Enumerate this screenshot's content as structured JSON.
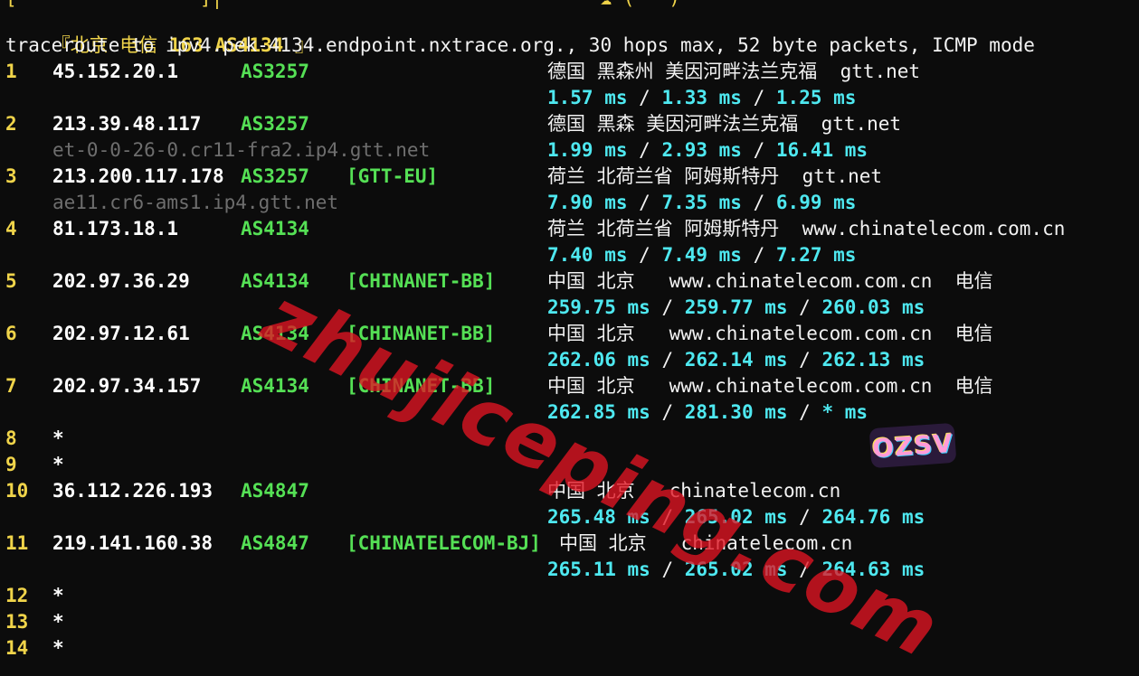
{
  "header": {
    "cut_top_text": "[                ]|                                 ☁ (   )",
    "location_prefix": "『北京 电信 ",
    "location_asn": "163 AS4134",
    "location_suffix": " 』",
    "command": "traceroute to ipv4.pek-4134.endpoint.nxtrace.org., 30 hops max, 52 byte packets, ICMP mode"
  },
  "hops": [
    {
      "num": "1",
      "ip": "45.152.20.1",
      "asn": "AS3257",
      "tag": "",
      "geo": "德国 黑森州 美因河畔法兰克福  gtt.net",
      "rdns": "",
      "rtt": [
        "1.57 ms",
        "1.33 ms",
        "1.25 ms"
      ]
    },
    {
      "num": "2",
      "ip": "213.39.48.117",
      "asn": "AS3257",
      "tag": "",
      "geo": "德国 黑森 美因河畔法兰克福  gtt.net",
      "rdns": "et-0-0-26-0.cr11-fra2.ip4.gtt.net",
      "rtt": [
        "1.99 ms",
        "2.93 ms",
        "16.41 ms"
      ]
    },
    {
      "num": "3",
      "ip": "213.200.117.178",
      "asn": "AS3257",
      "tag": "[GTT-EU]",
      "geo": "荷兰 北荷兰省 阿姆斯特丹  gtt.net",
      "rdns": "ae11.cr6-ams1.ip4.gtt.net",
      "rtt": [
        "7.90 ms",
        "7.35 ms",
        "6.99 ms"
      ]
    },
    {
      "num": "4",
      "ip": "81.173.18.1",
      "asn": "AS4134",
      "tag": "",
      "geo": "荷兰 北荷兰省 阿姆斯特丹  www.chinatelecom.com.cn",
      "rdns": "",
      "rtt": [
        "7.40 ms",
        "7.49 ms",
        "7.27 ms"
      ]
    },
    {
      "num": "5",
      "ip": "202.97.36.29",
      "asn": "AS4134",
      "tag": "[CHINANET-BB]",
      "geo": "中国 北京   www.chinatelecom.com.cn  电信",
      "rdns": "",
      "rtt": [
        "259.75 ms",
        "259.77 ms",
        "260.03 ms"
      ]
    },
    {
      "num": "6",
      "ip": "202.97.12.61",
      "asn": "AS4134",
      "tag": "[CHINANET-BB]",
      "geo": "中国 北京   www.chinatelecom.com.cn  电信",
      "rdns": "",
      "rtt": [
        "262.06 ms",
        "262.14 ms",
        "262.13 ms"
      ]
    },
    {
      "num": "7",
      "ip": "202.97.34.157",
      "asn": "AS4134",
      "tag": "[CHINANET-BB]",
      "geo": "中国 北京   www.chinatelecom.com.cn  电信",
      "rdns": "",
      "rtt": [
        "262.85 ms",
        "281.30 ms",
        "* ms"
      ]
    },
    {
      "num": "8",
      "ip": "*",
      "asn": "",
      "tag": "",
      "geo": "",
      "rdns": "",
      "rtt": []
    },
    {
      "num": "9",
      "ip": "*",
      "asn": "",
      "tag": "",
      "geo": "",
      "rdns": "",
      "rtt": []
    },
    {
      "num": "10",
      "ip": "36.112.226.193",
      "asn": "AS4847",
      "tag": "",
      "geo": "中国 北京   chinatelecom.cn",
      "rdns": "",
      "rtt": [
        "265.48 ms",
        "265.02 ms",
        "264.76 ms"
      ]
    },
    {
      "num": "11",
      "ip": "219.141.160.38",
      "asn": "AS4847",
      "tag": "[CHINATELECOM-BJ]",
      "geo": "中国 北京   chinatelecom.cn",
      "rdns": "",
      "rtt": [
        "265.11 ms",
        "265.02 ms",
        "264.63 ms"
      ]
    },
    {
      "num": "12",
      "ip": "*",
      "asn": "",
      "tag": "",
      "geo": "",
      "rdns": "",
      "rtt": []
    },
    {
      "num": "13",
      "ip": "*",
      "asn": "",
      "tag": "",
      "geo": "",
      "rdns": "",
      "rtt": []
    },
    {
      "num": "14",
      "ip": "*",
      "asn": "",
      "tag": "",
      "geo": "",
      "rdns": "",
      "rtt": []
    }
  ],
  "watermark": "zhujiceping.com",
  "badge": "OZSV",
  "colors": {
    "background": "#0c0c0c",
    "hop_number": "#f0d44a",
    "asn": "#55e055",
    "rtt": "#4ee8f0",
    "rdns": "#6e6e6e",
    "watermark": "#e11423"
  }
}
